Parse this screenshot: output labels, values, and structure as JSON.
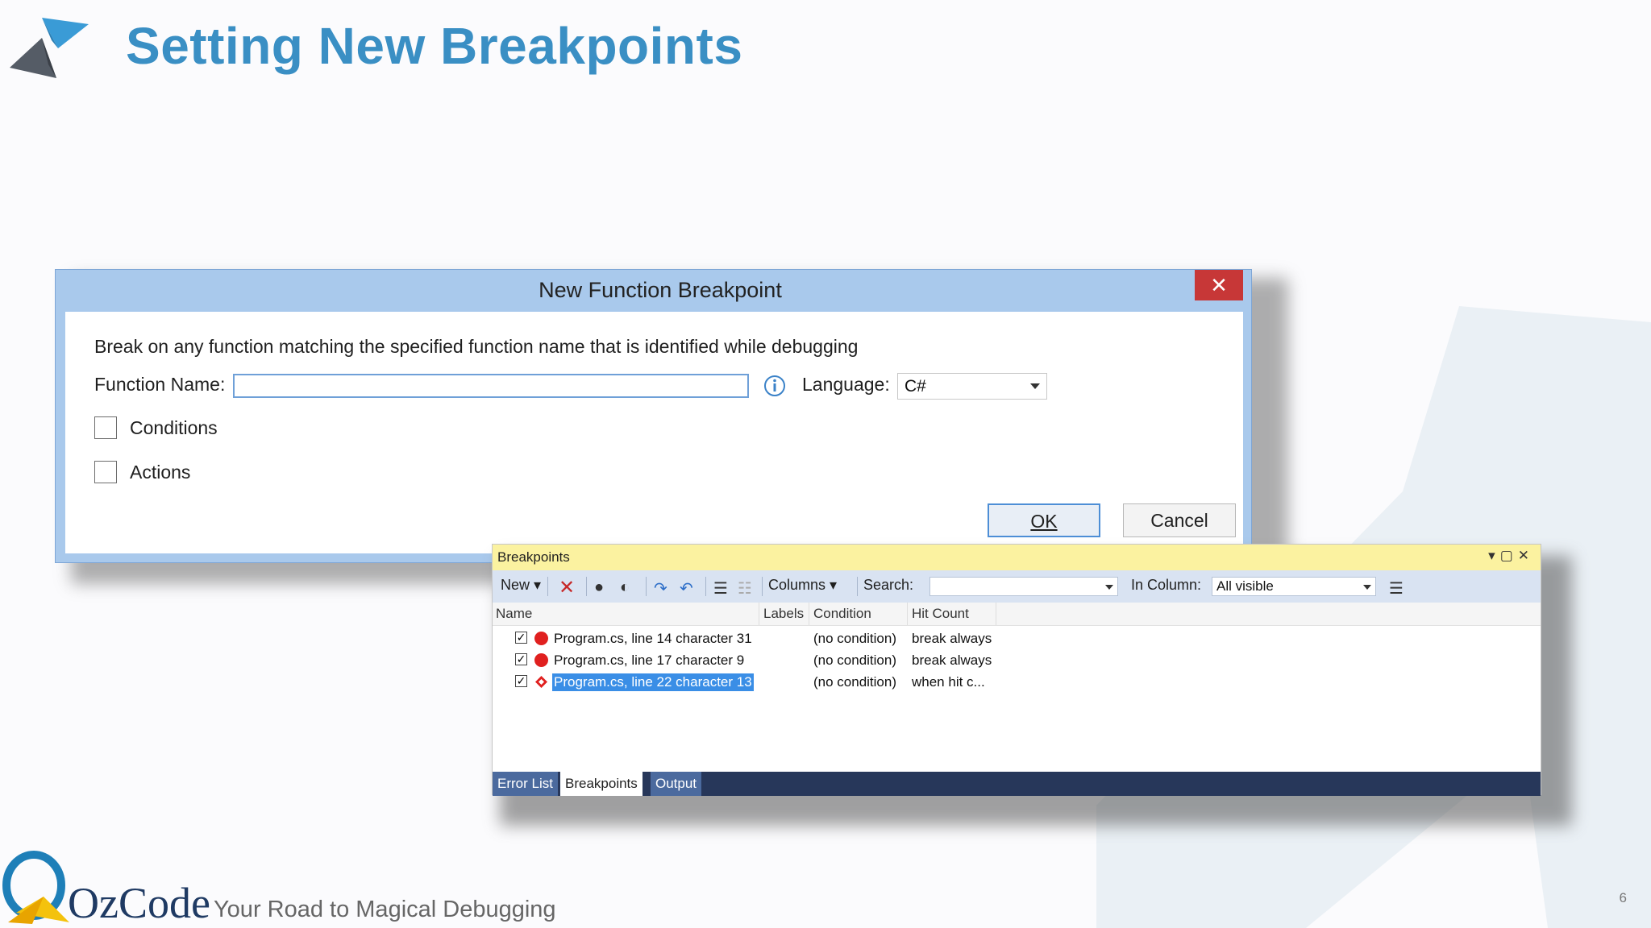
{
  "slide": {
    "title": "Setting New Breakpoints",
    "page_number": "6",
    "brand": "OzCode",
    "tagline": "Your Road to Magical Debugging"
  },
  "dialog": {
    "title": "New Function Breakpoint",
    "close_glyph": "✕",
    "description": "Break on any function matching the specified function name that is identified while debugging",
    "function_name_label": "Function Name:",
    "function_name_value": "",
    "language_label": "Language:",
    "language_value": "C#",
    "conditions_label": "Conditions",
    "actions_label": "Actions",
    "ok_label": "OK",
    "cancel_label": "Cancel"
  },
  "breakpoints": {
    "title": "Breakpoints",
    "toolbar": {
      "new_label": "New",
      "columns_label": "Columns",
      "search_label": "Search:",
      "search_value": "",
      "in_column_label": "In Column:",
      "in_column_value": "All visible"
    },
    "columns": [
      "Name",
      "Labels",
      "Condition",
      "Hit Count"
    ],
    "rows": [
      {
        "name": "Program.cs, line 14 character 31",
        "condition": "(no condition)",
        "hit_count": "break always",
        "checked": true,
        "selected": false,
        "icon": "breakpoint-dot"
      },
      {
        "name": "Program.cs, line 17 character 9",
        "condition": "(no condition)",
        "hit_count": "break always",
        "checked": true,
        "selected": false,
        "icon": "breakpoint-dot"
      },
      {
        "name": "Program.cs, line 22 character 13",
        "condition": "(no condition)",
        "hit_count": "when hit c...",
        "checked": true,
        "selected": true,
        "icon": "conditional-breakpoint-diamond"
      }
    ],
    "tabs": [
      "Error List",
      "Breakpoints",
      "Output"
    ],
    "active_tab": "Breakpoints"
  },
  "colors": {
    "title_blue": "#3a8fc4",
    "dialog_frame": "#a9c9ec",
    "close_red": "#c73737",
    "pane_title": "#fbf2a0",
    "selection": "#3a8ee6",
    "breakpoint_red": "#e0201f"
  }
}
